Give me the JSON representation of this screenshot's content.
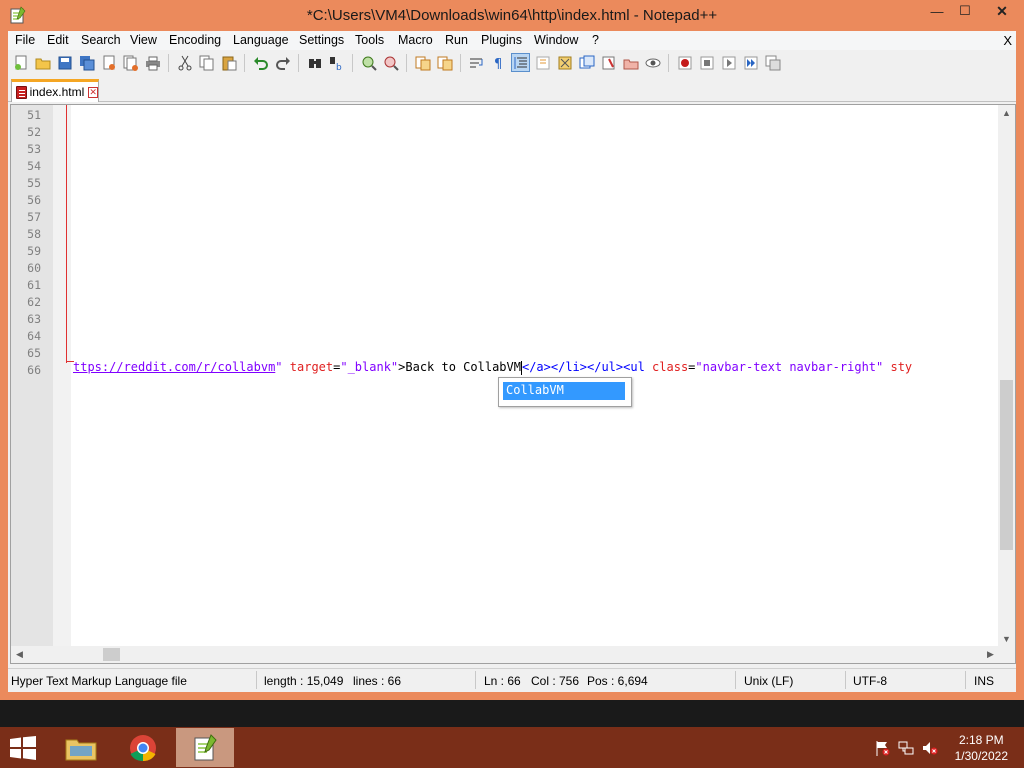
{
  "window": {
    "title": "*C:\\Users\\VM4\\Downloads\\win64\\http\\index.html - Notepad++",
    "minimize_glyph": "—",
    "maximize_glyph": "☐",
    "close_glyph": "✕"
  },
  "menu": {
    "items": [
      "File",
      "Edit",
      "Search",
      "View",
      "Encoding",
      "Language",
      "Settings",
      "Tools",
      "Macro",
      "Run",
      "Plugins",
      "Window",
      "?"
    ],
    "close_glyph": "X"
  },
  "toolbar": {
    "icons": [
      "new-file-icon",
      "open-file-icon",
      "save-icon",
      "save-all-icon",
      "close-icon",
      "close-all-icon",
      "print-icon",
      "cut-icon",
      "copy-icon",
      "paste-icon",
      "undo-icon",
      "redo-icon",
      "find-icon",
      "replace-icon",
      "zoom-in-icon",
      "zoom-out-icon",
      "sync-vertical-icon",
      "sync-horizontal-icon",
      "word-wrap-icon",
      "show-all-chars-icon",
      "indent-guide-icon",
      "user-language-icon",
      "doc-map-icon",
      "function-list-icon",
      "folder-as-workspace-icon",
      "document-list-icon",
      "monitoring-icon",
      "record-macro-icon",
      "stop-macro-icon",
      "play-macro-icon",
      "run-macro-multiple-icon",
      "save-macro-icon"
    ]
  },
  "tabs": [
    {
      "label": "index.html"
    }
  ],
  "editor": {
    "line_numbers": [
      "51",
      "52",
      "53",
      "54",
      "55",
      "56",
      "57",
      "58",
      "59",
      "60",
      "61",
      "62",
      "63",
      "64",
      "65",
      "66"
    ],
    "code_line": {
      "url": "ttps://reddit.com/r/collabvm",
      "url_close": "\"",
      "attr_target": "target",
      "eq1": "=",
      "target_val": "\"_blank\"",
      "text1": ">Back to CollabVM",
      "tag1": "</a></li></ul><ul",
      "attr_class": "class",
      "eq2": "=",
      "class_val": "\"navbar-text navbar-right\"",
      "attr_style": "sty"
    },
    "autocomplete": [
      "CollabVM"
    ]
  },
  "status": {
    "file_type": "Hyper Text Markup Language file",
    "length": "length : 15,049",
    "lines": "lines : 66",
    "ln": "Ln : 66",
    "col": "Col : 756",
    "pos": "Pos : 6,694",
    "eol": "Unix (LF)",
    "encoding": "UTF-8",
    "mode": "INS"
  },
  "taskbar": {
    "apps": [
      "file-explorer-icon",
      "chrome-icon",
      "notepad-plus-plus-icon"
    ],
    "tray": [
      "action-center-flag-icon",
      "network-icon",
      "volume-muted-icon"
    ],
    "time": "2:18 PM",
    "date": "1/30/2022"
  },
  "colors": {
    "window_frame": "#eb8a5c",
    "taskbar": "#7a2e18",
    "selection": "#3399ff",
    "url": "#8000ff",
    "attr": "#e02020",
    "tag": "#0000ff"
  }
}
